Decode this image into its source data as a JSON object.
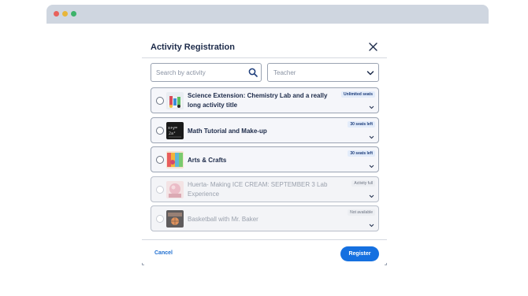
{
  "modal": {
    "title": "Activity Registration",
    "search_placeholder": "Search by activity",
    "teacher_select_value": "Teacher",
    "cancel_label": "Cancel",
    "register_label": "Register"
  },
  "activities": [
    {
      "title": "Science Extension: Chemistry Lab and a really long activity title",
      "badge": "Unlimited seats",
      "enabled": true
    },
    {
      "title": "Math Tutorial and Make-up",
      "badge": "30 seats left",
      "enabled": true
    },
    {
      "title": "Arts & Crafts",
      "badge": "30 seats left",
      "enabled": true
    },
    {
      "title": "Huerta- Making ICE CREAM: SEPTEMBER 3 Lab Experience",
      "badge": "Activity full",
      "enabled": false
    },
    {
      "title": "Basketball with Mr. Baker",
      "badge": "Not available",
      "enabled": false
    }
  ],
  "colors": {
    "accent": "#1570e0",
    "title": "#1d2b4a",
    "border": "#9aa3b2"
  },
  "icons": {
    "close": "close-icon",
    "search": "search-icon",
    "chevron": "chevron-down-icon"
  }
}
